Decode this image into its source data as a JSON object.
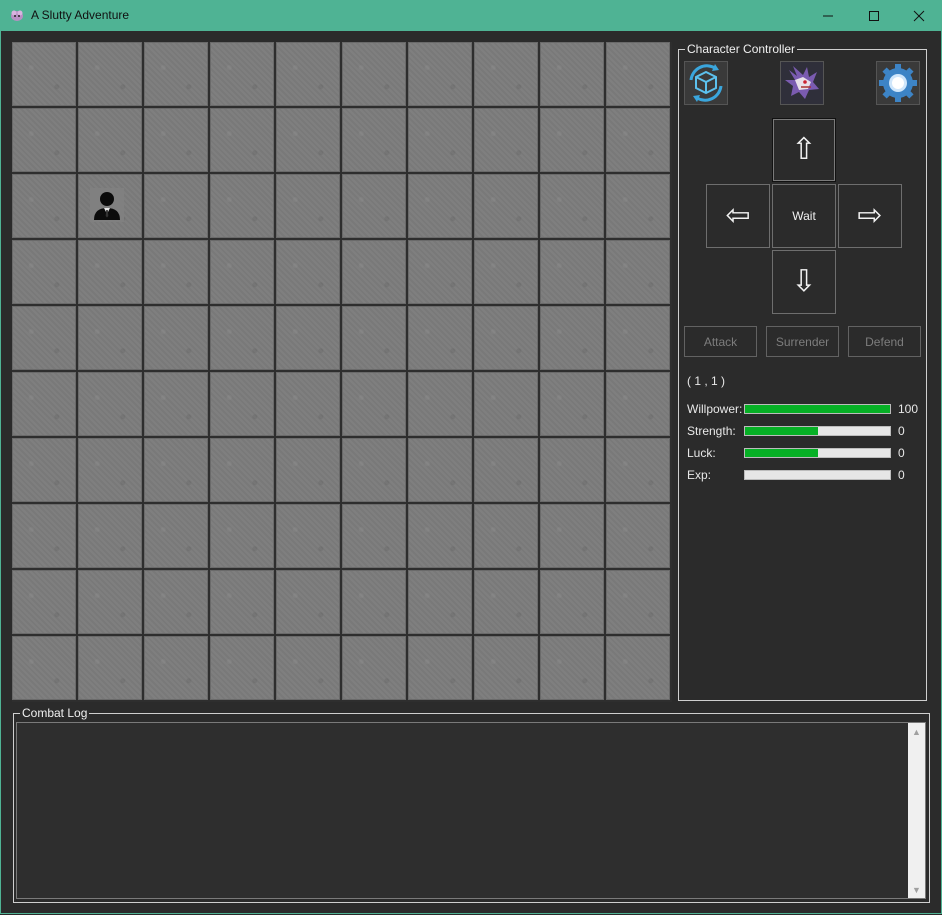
{
  "window": {
    "title": "A Slutty Adventure"
  },
  "map": {
    "columns": 10,
    "rows": 10,
    "player_position": {
      "column": 1,
      "row": 2
    }
  },
  "controller": {
    "label": "Character Controller",
    "icons": [
      "refresh-box-icon",
      "dragon-portrait-icon",
      "settings-gear-icon"
    ],
    "up": "⇧",
    "down": "⇩",
    "left": "⇦",
    "right": "⇨",
    "wait": "Wait",
    "actions": {
      "attack": "Attack",
      "surrender": "Surrender",
      "defend": "Defend"
    },
    "coords": "( 1 , 1 )",
    "stats": [
      {
        "label": "Willpower:",
        "value": "100",
        "fill": 1.0
      },
      {
        "label": "Strength:",
        "value": "0",
        "fill": 0.5
      },
      {
        "label": "Luck:",
        "value": "0",
        "fill": 0.5
      },
      {
        "label": "Exp:",
        "value": "0",
        "fill": 0.0
      }
    ],
    "bar_color": "#06b025"
  },
  "combat_log": {
    "label": "Combat Log",
    "text": ""
  }
}
